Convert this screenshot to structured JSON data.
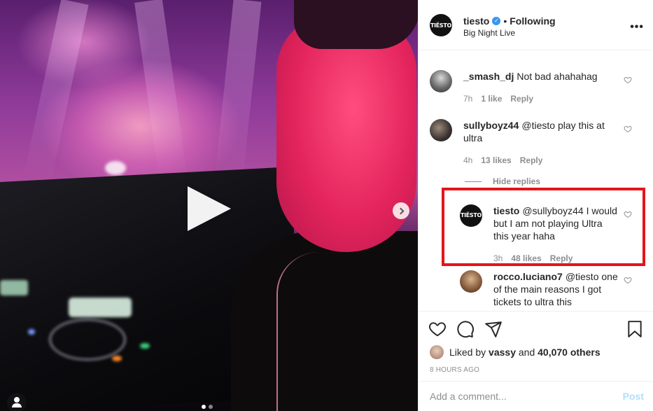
{
  "media": {
    "play_icon": "play-icon",
    "next_icon": "chevron-right-icon",
    "tag_icon": "user-tag-icon",
    "carousel": {
      "count": 2,
      "active": 1
    }
  },
  "header": {
    "username": "tiesto",
    "avatar_text": "TIËSTO",
    "verified_icon": "verified-badge-icon",
    "separator": "•",
    "follow_status": "Following",
    "location": "Big Night Live",
    "more_icon": "more-options-icon"
  },
  "comments": [
    {
      "username": "_smash_dj",
      "text": "Not bad ahahahag",
      "time": "7h",
      "likes": "1 like",
      "reply": "Reply"
    },
    {
      "username": "sullyboyz44",
      "text": "@tiesto play this at ultra",
      "time": "4h",
      "likes": "13 likes",
      "reply": "Reply"
    }
  ],
  "hide_replies": "Hide replies",
  "replies": [
    {
      "username": "tiesto",
      "avatar_text": "TIËSTO",
      "text": "@sullyboyz44 I would but I am not playing Ultra this year haha",
      "time": "3h",
      "likes": "48 likes",
      "reply": "Reply"
    },
    {
      "username": "rocco.luciano7",
      "text": "@tiesto one of the main reasons I got tickets to ultra this"
    }
  ],
  "actions": {
    "like_icon": "heart-icon",
    "comment_icon": "comment-icon",
    "share_icon": "paper-plane-icon",
    "save_icon": "bookmark-icon"
  },
  "likes": {
    "prefix": "Liked by",
    "user": "vassy",
    "conjunction": "and",
    "others": "40,070 others"
  },
  "time_ago": "8 HOURS AGO",
  "add_comment": {
    "placeholder": "Add a comment...",
    "post_label": "Post"
  },
  "colors": {
    "highlight_border": "#e3151b",
    "verified": "#3897f0",
    "post_disabled": "#b2dffc"
  }
}
